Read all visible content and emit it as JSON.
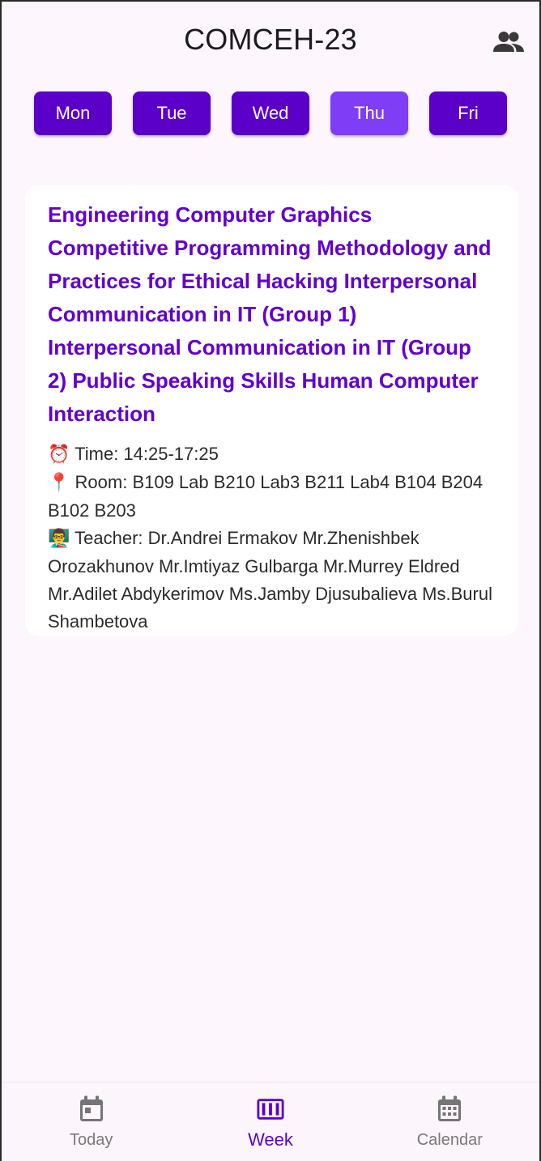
{
  "appbar": {
    "title": "COMCEH-23",
    "group_icon": "group-icon"
  },
  "days": [
    {
      "label": "Mon",
      "active": false
    },
    {
      "label": "Tue",
      "active": false
    },
    {
      "label": "Wed",
      "active": false
    },
    {
      "label": "Thu",
      "active": true
    },
    {
      "label": "Fri",
      "active": false
    }
  ],
  "lesson": {
    "title": "Engineering Computer Graphics Competitive Programming Methodology and Practices for Ethical Hacking Interpersonal Communication in IT (Group 1) Interpersonal Communication in IT (Group 2) Public Speaking Skills Human Computer Interaction",
    "time_icon": "⏰",
    "time_text": "Time: 14:25-17:25",
    "room_icon": "📍",
    "room_text": "Room: B109 Lab B210 Lab3 B211 Lab4 B104 B204 B102 B203",
    "teacher_icon": "👨‍🏫",
    "teacher_text": "Teacher: Dr.Andrei Ermakov Mr.Zhenishbek Orozakhunov Mr.Imtiyaz Gulbarga Mr.Murrey Eldred Mr.Adilet Abdykerimov Ms.Jamby Djusubalieva Ms.Burul Shambetova"
  },
  "bottom_nav": {
    "today": "Today",
    "week": "Week",
    "calendar": "Calendar",
    "active": "week"
  },
  "colors": {
    "primary": "#5a00c8",
    "primary_active": "#7f3df5",
    "title_purple": "#6200cc",
    "background": "#fdf7fd",
    "inactive_icon": "#757575"
  }
}
